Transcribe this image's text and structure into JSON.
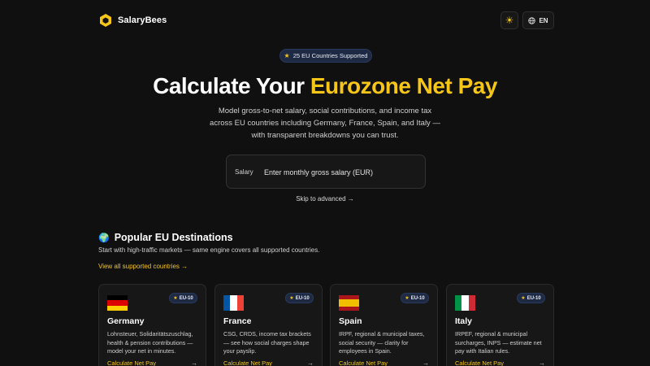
{
  "brand": {
    "name": "SalaryBees",
    "logo_icon": "hexagon-icon",
    "accent": "#f5c518"
  },
  "header": {
    "theme_icon": "sun-icon",
    "language_icon": "globe-icon",
    "language_label": "EN"
  },
  "hero": {
    "badge_icon": "star-icon",
    "badge_text": "25 EU Countries Supported",
    "title_main": "Calculate Your ",
    "title_accent": "Eurozone Net Pay",
    "description": "Model gross-to-net salary, social contributions, and income tax across EU countries including Germany, France, Spain, and Italy — with transparent breakdowns you can trust."
  },
  "salary_form": {
    "label": "Salary",
    "value": "",
    "placeholder": "Enter monthly gross salary (EUR)",
    "skip_link": "Skip to advanced →"
  },
  "destinations": {
    "icon": "globe-emoji-icon",
    "title": "Popular EU Destinations",
    "subtitle": "Start with high-traffic markets — same engine covers all supported countries.",
    "view_all": "View all supported countries →",
    "cards": [
      {
        "country": "Germany",
        "flag_colors": [
          "#000000",
          "#dd0000",
          "#ffce00"
        ],
        "badge": "EU-10",
        "description": "Lohnsteuer, Solidaritätszuschlag, health & pension contributions — model your net in minutes.",
        "cta": "Calculate Net Pay",
        "arrow": "→"
      },
      {
        "country": "France",
        "flag_colors": [
          "#0055a4",
          "#ffffff",
          "#ef4135"
        ],
        "badge": "EU-10",
        "description": "CSG, CRDS, income tax brackets — see how social charges shape your payslip.",
        "cta": "Calculate Net Pay",
        "arrow": "→"
      },
      {
        "country": "Spain",
        "flag_colors": [
          "#aa151b",
          "#f1bf00",
          "#aa151b"
        ],
        "badge": "EU-10",
        "description": "IRPF, regional & municipal taxes, social security — clarity for employees in Spain.",
        "cta": "Calculate Net Pay",
        "arrow": "→"
      },
      {
        "country": "Italy",
        "flag_colors": [
          "#009246",
          "#ffffff",
          "#ce2b37"
        ],
        "badge": "EU-10",
        "description": "IRPEF, regional & municipal surcharges, INPS — estimate net pay with Italian rules.",
        "cta": "Calculate Net Pay",
        "arrow": "→"
      }
    ]
  }
}
